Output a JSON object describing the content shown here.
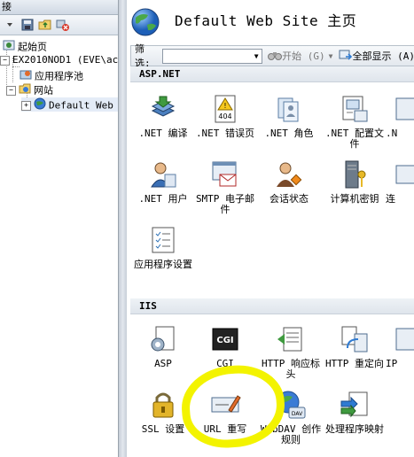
{
  "left_pane": {
    "header": "接",
    "tree": [
      {
        "label": "起始页"
      },
      {
        "label": "EX2010NOD1 (EVE\\ac"
      },
      {
        "label": "应用程序池"
      },
      {
        "label": "网站"
      },
      {
        "label": "Default Web"
      }
    ],
    "expander_minus": "−",
    "expander_plus": "+"
  },
  "main": {
    "title": "Default Web Site 主页",
    "filter": {
      "label": "筛选:",
      "input_value": "",
      "start_label": "开始 (G)",
      "show_all_label": "全部显示 (A)"
    },
    "groups": [
      {
        "name": "ASP.NET",
        "features": [
          {
            "label": ".NET 编译",
            "icon": "net-compile-icon"
          },
          {
            "label": ".NET 错误页",
            "icon": "net-error-page-icon"
          },
          {
            "label": ".NET 角色",
            "icon": "net-roles-icon"
          },
          {
            "label": ".NET 配置文件",
            "icon": "net-profile-icon"
          },
          {
            "label": ".N",
            "icon": "net-partial-icon"
          },
          {
            "label": ".NET 用户",
            "icon": "net-users-icon"
          },
          {
            "label": "SMTP 电子邮件",
            "icon": "smtp-email-icon"
          },
          {
            "label": "会话状态",
            "icon": "session-state-icon"
          },
          {
            "label": "计算机密钥",
            "icon": "machine-key-icon"
          },
          {
            "label": "连",
            "icon": "connection-partial-icon"
          },
          {
            "label": "应用程序设置",
            "icon": "app-settings-icon"
          }
        ]
      },
      {
        "name": "IIS",
        "features": [
          {
            "label": "ASP",
            "icon": "asp-icon"
          },
          {
            "label": "CGI",
            "icon": "cgi-icon"
          },
          {
            "label": "HTTP 响应标头",
            "icon": "http-response-headers-icon"
          },
          {
            "label": "HTTP 重定向",
            "icon": "http-redirect-icon"
          },
          {
            "label": "IP",
            "icon": "ip-partial-icon"
          },
          {
            "label": "SSL 设置",
            "icon": "ssl-settings-icon"
          },
          {
            "label": "URL 重写",
            "icon": "url-rewrite-icon"
          },
          {
            "label": "WebDAV 创作规则",
            "icon": "webdav-icon"
          },
          {
            "label": "处理程序映射",
            "icon": "handler-mappings-icon"
          }
        ]
      }
    ]
  },
  "colors": {
    "annotation": "#f3f300",
    "group_header": "#dfe5ec",
    "selected": "#e4ecf7"
  }
}
